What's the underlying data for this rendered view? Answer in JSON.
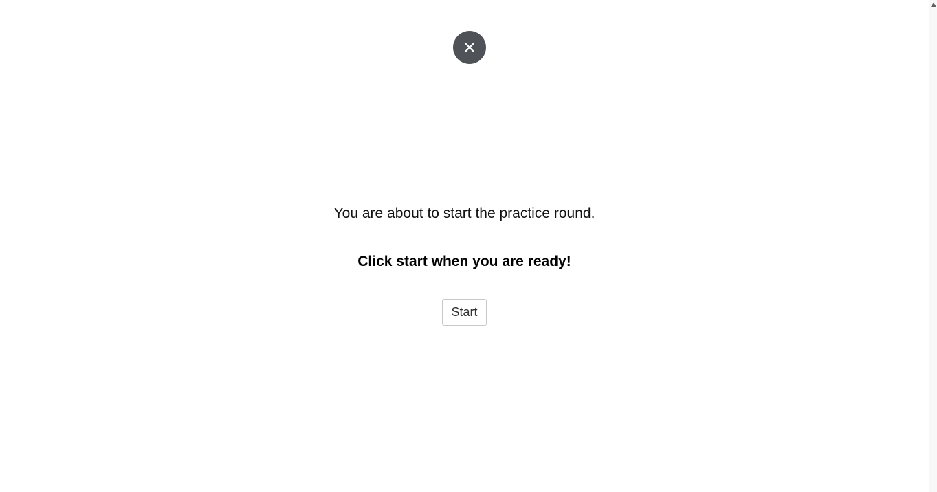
{
  "dialog": {
    "close_icon": "close-icon",
    "intro_text": "You are about to start the practice round.",
    "ready_text": "Click start when you are ready!",
    "start_label": "Start"
  },
  "colors": {
    "close_button_bg": "#4f5257",
    "close_icon": "#ffffff"
  },
  "scrollbar": {
    "up_arrow_icon": "arrow-up-icon"
  }
}
